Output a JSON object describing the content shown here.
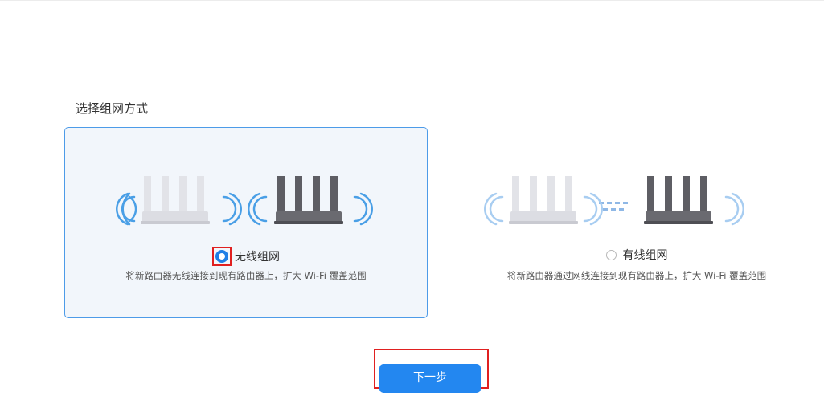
{
  "title": "选择组网方式",
  "options": [
    {
      "label": "无线组网",
      "description": "将新路由器无线连接到现有路由器上，扩大 Wi-Fi 覆盖范围",
      "selected": true
    },
    {
      "label": "有线组网",
      "description": "将新路由器通过网线连接到现有路由器上，扩大 Wi-Fi 覆盖范围",
      "selected": false
    }
  ],
  "next_button": {
    "label": "下一步"
  },
  "colors": {
    "accent": "#2387f0",
    "card_border": "#4d9be8",
    "card_fill": "#f2f6fb",
    "highlight": "#e02020"
  }
}
